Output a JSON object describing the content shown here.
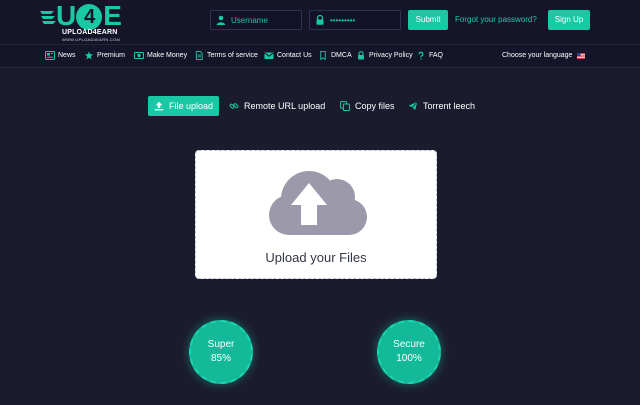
{
  "header": {
    "logo": {
      "mark": "U4E",
      "name": "UPLOAD4EARN",
      "url": "WWW.UPLOAD4EARN.COM"
    },
    "login": {
      "username_placeholder": "Username",
      "password_value": "•••••••••",
      "submit_label": "Submit",
      "forgot_label": "Forgot your password?",
      "signup_label": "Sign Up"
    }
  },
  "nav": {
    "items": [
      {
        "label": "News",
        "icon": "newspaper-icon"
      },
      {
        "label": "Premium",
        "icon": "star-icon"
      },
      {
        "label": "Make Money",
        "icon": "money-icon"
      },
      {
        "label": "Terms of service",
        "icon": "document-icon"
      },
      {
        "label": "Contact Us",
        "icon": "envelope-icon"
      },
      {
        "label": "DMCA",
        "icon": "bookmark-icon"
      },
      {
        "label": "Privacy Policy",
        "icon": "lock-icon"
      },
      {
        "label": "FAQ",
        "icon": "question-icon"
      }
    ],
    "language_label": "Choose your language",
    "language_flag": "us-flag-icon"
  },
  "tabs": [
    {
      "label": "File upload",
      "icon": "upload-icon",
      "active": true
    },
    {
      "label": "Remote URL upload",
      "icon": "link-icon",
      "active": false
    },
    {
      "label": "Copy files",
      "icon": "copy-icon",
      "active": false
    },
    {
      "label": "Torrent leech",
      "icon": "send-icon",
      "active": false
    }
  ],
  "upload": {
    "text": "Upload your Files",
    "icon": "cloud-upload-icon"
  },
  "stats": [
    {
      "label": "Super",
      "value": "85%"
    },
    {
      "label": "Secure",
      "value": "100%"
    }
  ],
  "colors": {
    "accent": "#19c9a6",
    "background": "#1b1b2e",
    "header": "#15152a",
    "upload_icon": "#9c9aaa"
  }
}
